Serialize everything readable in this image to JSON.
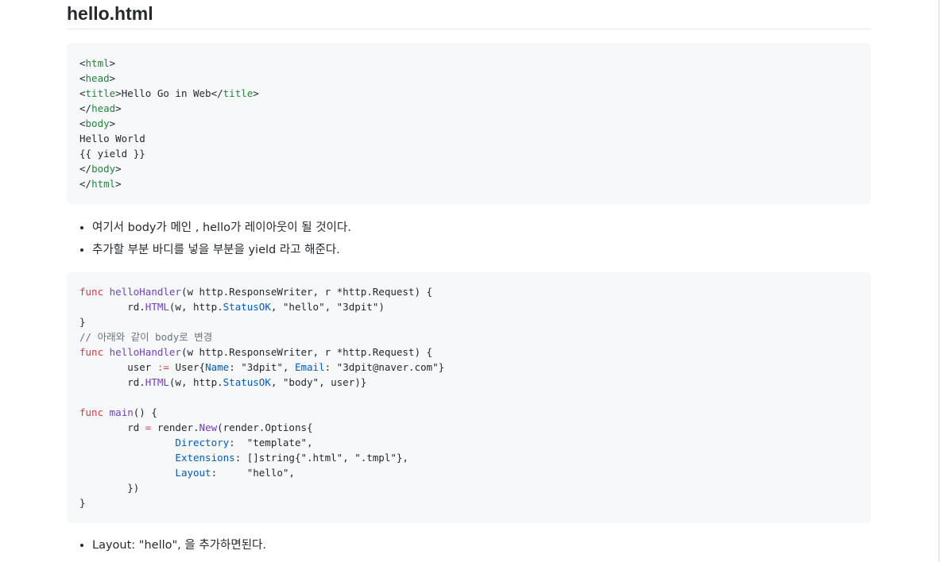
{
  "heading": "hello.html",
  "html_code": {
    "l1": {
      "open": "<",
      "tag": "html",
      "close": ">"
    },
    "l2": {
      "open": "<",
      "tag": "head",
      "close": ">"
    },
    "l3": {
      "open": "<",
      "tag": "title",
      "mid": ">Hello Go in Web</",
      "tag2": "title",
      "close": ">"
    },
    "l4": {
      "open": "</",
      "tag": "head",
      "close": ">"
    },
    "l5": {
      "open": "<",
      "tag": "body",
      "close": ">"
    },
    "l6": "Hello World",
    "l7": "{{ yield }}",
    "l8": {
      "open": "</",
      "tag": "body",
      "close": ">"
    },
    "l9": {
      "open": "</",
      "tag": "html",
      "close": ">"
    }
  },
  "bullets_1": [
    "여기서 body가 메인 , hello가 레이아웃이 될 것이다.",
    "추가할 부분 바디를 넣을 부분을 yield 라고 해준다."
  ],
  "go_code": {
    "func": "func",
    "helloHandler": "helloHandler",
    "sig": "(w http.ResponseWriter, r *http.Request) {",
    "indent1": "        ",
    "indent2": "                ",
    "rd_dot": "rd.",
    "HTML": "HTML",
    "w_http": "(w, http.",
    "StatusOK": "StatusOK",
    "args1": ", \"hello\", \"3dpit\")",
    "close_brace": "}",
    "comment": "// 아래와 같이 body로 변경",
    "user_pre": "user ",
    "assign": ":=",
    "user_struct": " User{",
    "Name": "Name",
    "name_val": ": \"3dpit\", ",
    "Email": "Email",
    "email_val": ": \"3dpit@naver.com\"}",
    "args2": ", \"body\", user)}",
    "main": "main",
    "main_sig": "() {",
    "rd_eq_pre": "rd ",
    "eq": "=",
    "render_pre": " render.",
    "New": "New",
    "render_opts": "(render.Options{",
    "Directory": "Directory",
    "dir_val": ":  \"template\",",
    "Extensions": "Extensions",
    "ext_val": ": []string{\".html\", \".tmpl\"},",
    "Layout": "Layout",
    "layout_val": ":     \"hello\",",
    "close_paren": "})"
  },
  "bullets_2": [
    "Layout: \"hello\", 을 추가하면된다."
  ]
}
